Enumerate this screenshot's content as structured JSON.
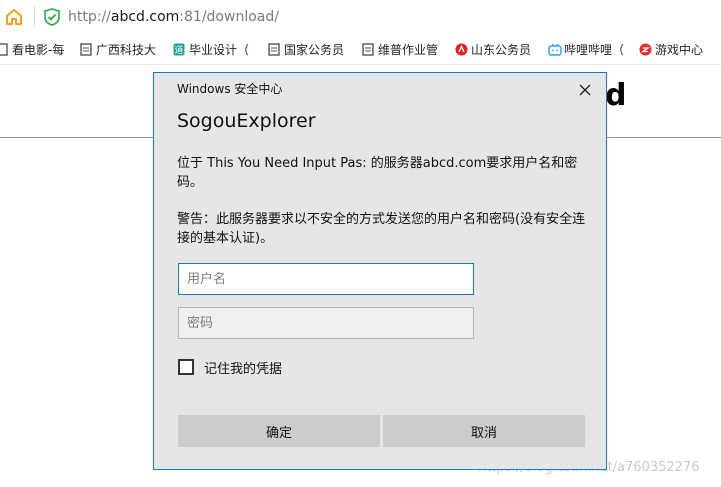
{
  "browser": {
    "url": {
      "scheme": "http://",
      "host": "abcd.com",
      "path": ":81/download/"
    },
    "bookmarks": [
      {
        "label": "看电影-每",
        "icon": "film-icon"
      },
      {
        "label": "广西科技大",
        "icon": "page-icon"
      },
      {
        "label": "毕业设计（",
        "icon": "design-icon"
      },
      {
        "label": "国家公务员",
        "icon": "page-icon"
      },
      {
        "label": "维普作业管",
        "icon": "page-icon"
      },
      {
        "label": "山东公务员",
        "icon": "red-logo-icon"
      },
      {
        "label": "哔哩哔哩（",
        "icon": "bilibili-icon"
      },
      {
        "label": "游戏中心",
        "icon": "game-icon"
      }
    ]
  },
  "page": {
    "heading_fragment": "d",
    "watermark": "https://blog.csdn.net/a760352276"
  },
  "dialog": {
    "caption": "Windows 安全中心",
    "title": "SogouExplorer",
    "message": "位于 This You Need Input Pas: 的服务器abcd.com要求用户名和密码。",
    "warning": "警告：此服务器要求以不安全的方式发送您的用户名和密码(没有安全连接的基本认证)。",
    "username_placeholder": "用户名",
    "password_placeholder": "密码",
    "remember_label": "记住我的凭据",
    "ok_label": "确定",
    "cancel_label": "取消"
  },
  "colors": {
    "accent": "#1979ca",
    "dialog_bg": "#e6e6e6",
    "button_bg": "#cccccc"
  }
}
